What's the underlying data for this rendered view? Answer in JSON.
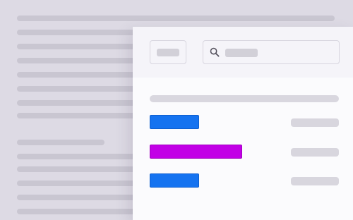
{
  "background_document": {
    "paragraph_1_lines": 8,
    "paragraph_2_lines": 5
  },
  "panel": {
    "header": {
      "filter_button": {},
      "search": {
        "icon": "search-icon"
      }
    },
    "table": {
      "column_header": {},
      "rows": [
        {
          "color": "#1573f0",
          "border": "#0e5fd0"
        },
        {
          "color": "#c200e6",
          "border": "#a000c0"
        },
        {
          "color": "#1573f0",
          "border": "#0e5fd0"
        }
      ]
    }
  }
}
